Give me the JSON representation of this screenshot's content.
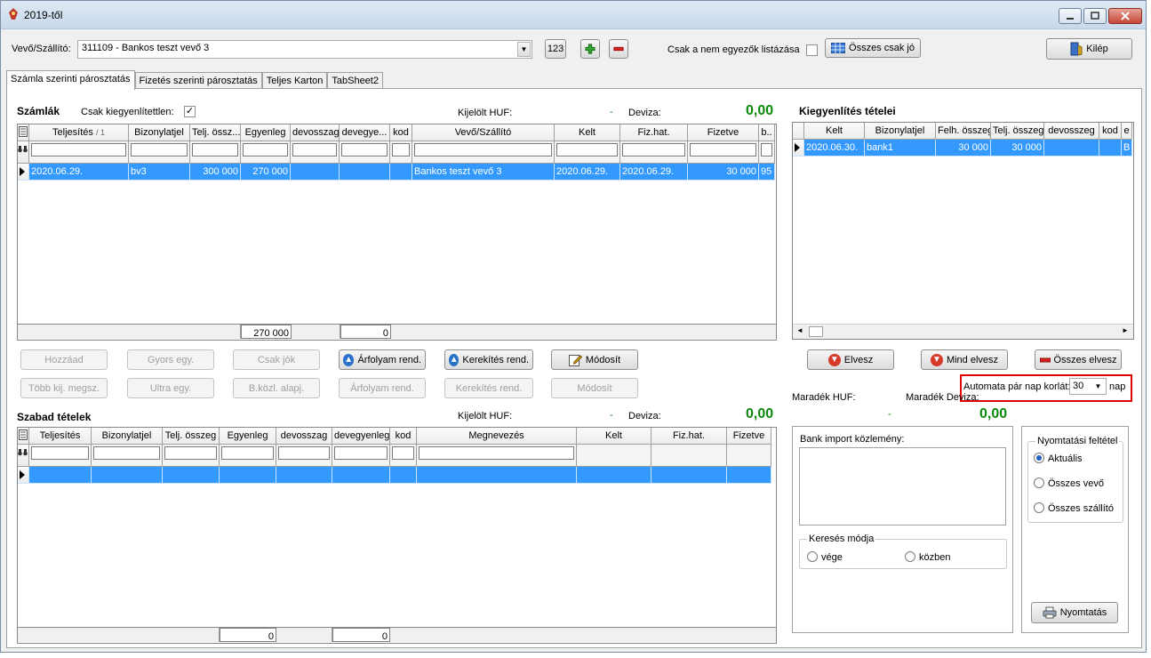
{
  "window": {
    "title": "2019-től"
  },
  "toolbar": {
    "vevo_label": "Vevő/Szállító:",
    "vevo_value": "311109 - Bankos teszt vevő 3",
    "btn_123": "123",
    "csak_label": "Csak a nem egyezők listázása",
    "osszes_csak_jo": "Összes csak jó",
    "kilep": "Kilép"
  },
  "tabs": [
    "Számla szerinti párosztatás",
    "Fizetés szerinti párosztatás",
    "Teljes Karton",
    "TabSheet2"
  ],
  "szamlak": {
    "title": "Számlák",
    "csak_kiegy_label": "Csak kiegyenlítettlen:",
    "kijelolt_label": "Kijelölt HUF:",
    "kijelolt_value": "-",
    "deviza_label": "Deviza:",
    "deviza_value": "0,00",
    "columns": [
      "Teljesítés",
      "Bizonylatjel",
      "Telj. össz...",
      "Egyenleg",
      "devosszag",
      "devegye...",
      "kod",
      "Vevő/Szállító",
      "Kelt",
      "Fiz.hat.",
      "Fizetve",
      "b.."
    ],
    "sort_marker": "/ 1",
    "row": [
      "2020.06.29.",
      "bv3",
      "300 000",
      "270 000",
      "",
      "",
      "",
      "Bankos teszt vevő 3",
      "2020.06.29.",
      "2020.06.29.",
      "30 000",
      "95"
    ],
    "footer_egyenleg": "270 000",
    "footer_devegy": "0"
  },
  "buttons_row1": {
    "hozzaad": "Hozzáad",
    "gyors_egy": "Gyors egy.",
    "csak_jok": "Csak jók",
    "arfolyam_rend": "Árfolyam rend.",
    "kerekites_rend": "Kerekítés rend.",
    "modosit": "Módosít"
  },
  "buttons_row2": {
    "tobb_kij": "Több kij. megsz.",
    "ultra_egy": "Ultra egy.",
    "bkozl": "B.közl. alapj.",
    "arfolyam_rend": "Árfolyam rend.",
    "kerekites_rend": "Kerekítés rend.",
    "modosit": "Módosít"
  },
  "szabad": {
    "title": "Szabad tételek",
    "kijelolt_label": "Kijelölt HUF:",
    "kijelolt_value": "-",
    "deviza_label": "Deviza:",
    "deviza_value": "0,00",
    "columns": [
      "Teljesítés",
      "Bizonylatjel",
      "Telj. összeg",
      "Egyenleg",
      "devosszag",
      "devegyenleg",
      "kod",
      "Megnevezés",
      "Kelt",
      "Fiz.hat.",
      "Fizetve"
    ],
    "footer_egyenleg": "0",
    "footer_devegy": "0"
  },
  "kiegy": {
    "title": "Kiegyenlítés tételei",
    "columns": [
      "Kelt",
      "Bizonylatjel",
      "Felh. összeg",
      "Telj. összeg",
      "devosszeg",
      "kod",
      "e"
    ],
    "row": [
      "2020.06.30.",
      "bank1",
      "30 000",
      "30 000",
      "",
      "",
      "B"
    ]
  },
  "right_buttons": {
    "elvesz": "Elvesz",
    "mind_elvesz": "Mind elvesz",
    "osszes_elvesz": "Összes elvesz"
  },
  "automata": {
    "label": "Automata pár nap korlát:",
    "value": "30",
    "unit": "nap"
  },
  "maradek": {
    "huf_label": "Maradék HUF:",
    "deviza_label": "Maradék Deviza:",
    "huf_value": "-",
    "deviza_value": "0,00"
  },
  "bank_import": {
    "label": "Bank import közlemény:"
  },
  "kereses": {
    "title": "Keresés módja",
    "opt1": "vége",
    "opt2": "közben"
  },
  "nyomtatas": {
    "title": "Nyomtatási feltétel",
    "opt1": "Aktuális",
    "opt2": "Összes vevő",
    "opt3": "Összes szállító",
    "button": "Nyomtatás"
  },
  "colors": {
    "selection": "#3399ff",
    "green": "#0a8a0a",
    "highlight": "#e00000"
  }
}
